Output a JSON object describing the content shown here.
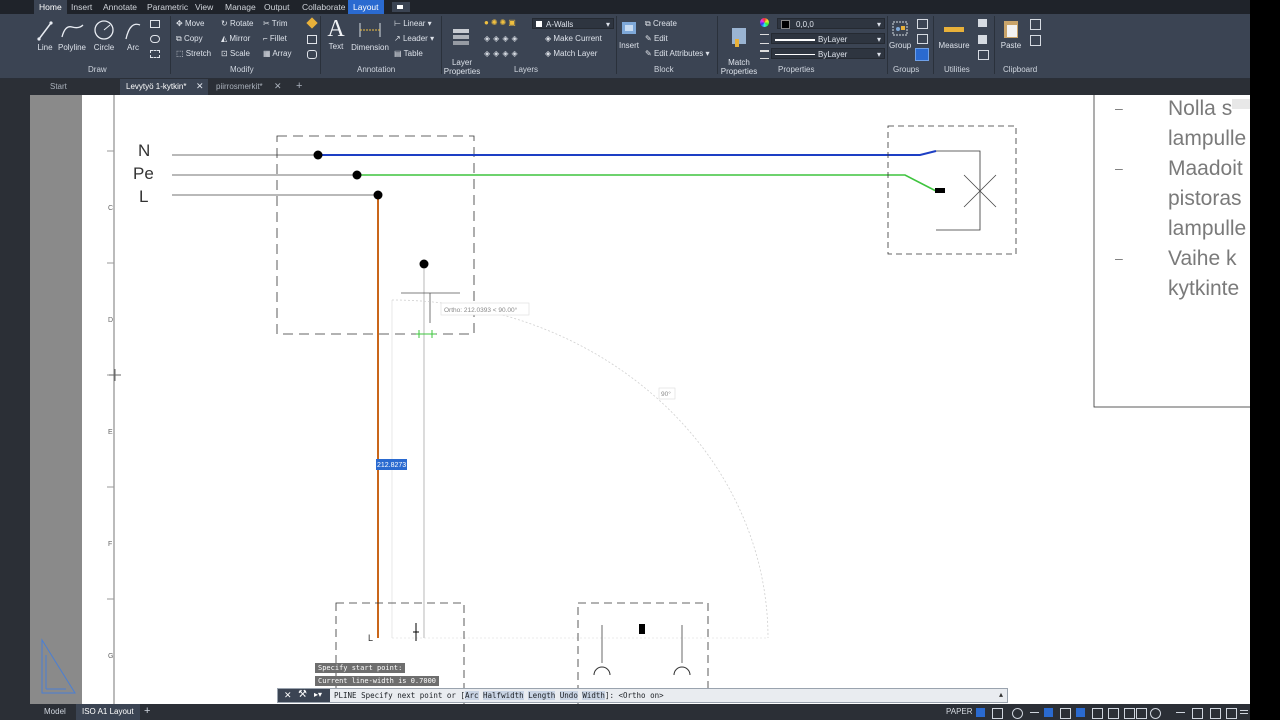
{
  "ribbon_tabs": [
    "Home",
    "Insert",
    "Annotate",
    "Parametric",
    "View",
    "Manage",
    "Output",
    "Collaborate",
    "Layout"
  ],
  "draw": {
    "line": "Line",
    "polyline": "Polyline",
    "circle": "Circle",
    "arc": "Arc",
    "title": "Draw"
  },
  "modify": {
    "move": "Move",
    "rotate": "Rotate",
    "trim": "Trim",
    "copy": "Copy",
    "mirror": "Mirror",
    "fillet": "Fillet",
    "stretch": "Stretch",
    "scale": "Scale",
    "array": "Array",
    "title": "Modify"
  },
  "annotation": {
    "text": "Text",
    "dimension": "Dimension",
    "linear": "Linear",
    "leader": "Leader",
    "table": "Table",
    "title": "Annotation"
  },
  "layers": {
    "layer_properties": "Layer\nProperties",
    "current_layer": "A-Walls",
    "make_current": "Make Current",
    "match_layer": "Match Layer",
    "title": "Layers"
  },
  "block": {
    "insert": "Insert",
    "create": "Create",
    "edit": "Edit",
    "edit_attributes": "Edit Attributes",
    "title": "Block"
  },
  "properties": {
    "match_properties": "Match\nProperties",
    "color_value": "0,0,0",
    "linetype": "ByLayer",
    "lineweight": "ByLayer",
    "title": "Properties"
  },
  "groups": {
    "group": "Group",
    "title": "Groups"
  },
  "utilities": {
    "measure": "Measure",
    "title": "Utilities"
  },
  "clipboard": {
    "paste": "Paste",
    "title": "Clipboard"
  },
  "doc_tabs": [
    "Start",
    "Levytyö 1-kytkin*",
    "piirrosmerkit*"
  ],
  "drawing": {
    "labels": {
      "n": "N",
      "pe": "Pe",
      "l": "L",
      "l_small": "L"
    },
    "ruler_letters": [
      "C",
      "D",
      "E",
      "F",
      "G"
    ],
    "notes": [
      {
        "dash": "–",
        "lines": [
          "Nolla s",
          "lampulle"
        ]
      },
      {
        "dash": "–",
        "lines": [
          "Maadoit",
          "pistoras",
          "lampulle"
        ]
      },
      {
        "dash": "–",
        "lines": [
          "Vaihe k",
          "kytkinte"
        ]
      }
    ],
    "ortho_tooltip": "Ortho: 212.0393 < 90.00°",
    "angle_label": "90°",
    "length_input": "212.8273"
  },
  "command": {
    "prompt1": "Specify start point:",
    "prompt2": "Current line-width is 0.7000",
    "prefix": "PLINE Specify next point or [",
    "options": [
      "Arc",
      "Halfwidth",
      "Length",
      "Undo",
      "Width"
    ],
    "suffix": "]:  <Ortho on>"
  },
  "layout_tabs": [
    "Model",
    "ISO A1 Layout"
  ],
  "status": {
    "paper": "PAPER"
  },
  "colors": {
    "neutral": "#1d3fc4",
    "earth": "#3ec43e",
    "phase": "#c9661a",
    "accent": "#2a6ad0"
  }
}
